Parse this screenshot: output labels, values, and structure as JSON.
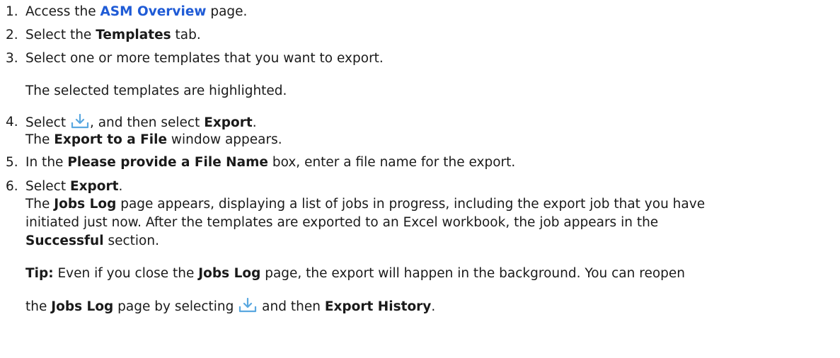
{
  "steps": [
    {
      "n": "1.",
      "pre": "Access the ",
      "link": "ASM Overview",
      "post": " page."
    },
    {
      "n": "2.",
      "pre": "Select the ",
      "bold": "Templates",
      "post": " tab."
    },
    {
      "n": "3.",
      "text": "Select one or more templates that you want to export.",
      "note": "The selected templates are highlighted."
    },
    {
      "n": "4.",
      "pre": "Select ",
      "mid": ", and then select ",
      "bold": "Export",
      "post": ".",
      "sub_pre": "The ",
      "sub_bold": "Export to a File",
      "sub_post": " window appears."
    },
    {
      "n": "5.",
      "pre": "In the ",
      "bold": "Please provide a File Name",
      "post": " box, enter a file name for the export."
    },
    {
      "n": "6.",
      "pre": "Select ",
      "bold": "Export",
      "post": ".",
      "d1_pre": "The ",
      "d1_bold": "Jobs Log",
      "d1_post": " page appears, displaying a list of jobs in progress, including the export job that you have",
      "d2": "initiated just now. After the templates are exported to an Excel workbook, the job appears in the",
      "d3_bold": "Successful",
      "d3_post": " section."
    }
  ],
  "tip": {
    "label": "Tip:",
    "l1_pre": " Even if you close the ",
    "l1_bold": "Jobs Log",
    "l1_post": " page, the export will happen in the background. You can reopen",
    "l2_pre": "the ",
    "l2_bold": "Jobs Log",
    "l2_mid": " page by selecting ",
    "l2_post": " and then ",
    "l2_bold2": "Export History",
    "l2_end": "."
  },
  "icons": [
    "download-icon"
  ],
  "colors": {
    "link": "#1f5bd6",
    "icon": "#5aa8e0",
    "text": "#1a1a1a"
  }
}
